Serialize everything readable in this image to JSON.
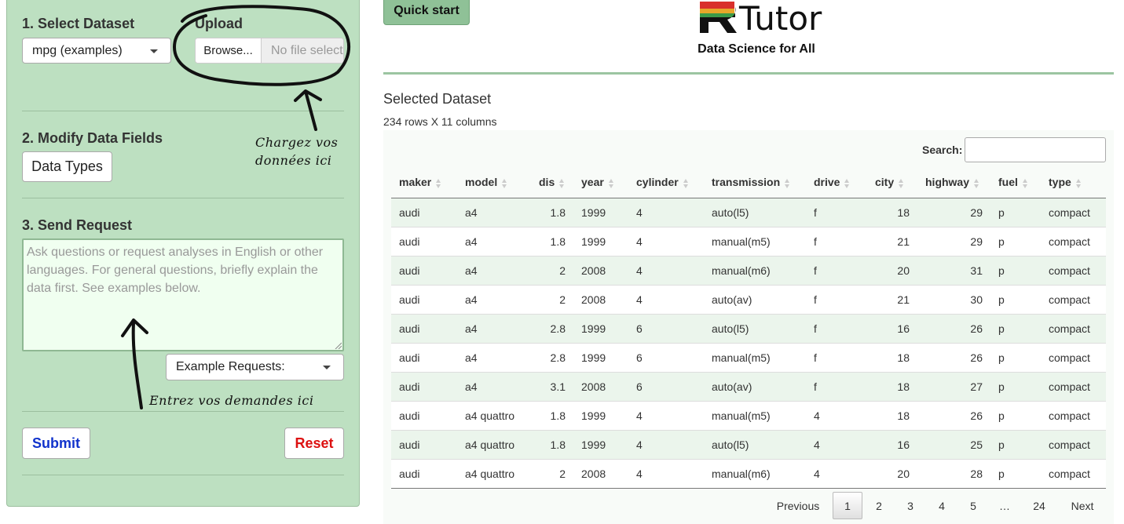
{
  "sidebar": {
    "select_dataset_label": "1. Select Dataset",
    "dataset_value": "mpg (examples)",
    "upload_label": "Upload",
    "browse_label": "Browse...",
    "file_placeholder": "No file selected",
    "modify_label": "2. Modify Data Fields",
    "data_types_label": "Data Types",
    "send_request_label": "3. Send Request",
    "request_placeholder": "Ask questions or request analyses in English or other languages. For general questions, briefly explain the data first. See examples below.",
    "example_requests_label": "Example Requests:",
    "submit_label": "Submit",
    "reset_label": "Reset",
    "annotation_upload": [
      "Chargez vos",
      "données ici"
    ],
    "annotation_request": "Entrez vos demandes ici"
  },
  "colors": {
    "submit": "#1133cc",
    "reset": "#dd1111",
    "sidebar_bg": "#bde0c1",
    "accent": "#8fc197"
  },
  "main": {
    "quick_start_label": "Quick start",
    "logo_text": "Tutor",
    "tagline": "Data Science for All",
    "section_title": "Selected Dataset",
    "dims_text": "234 rows X 11 columns",
    "search_label": "Search:",
    "search_value": ""
  },
  "table": {
    "columns": [
      "maker",
      "model",
      "dis",
      "year",
      "cylinder",
      "transmission",
      "drive",
      "city",
      "highway",
      "fuel",
      "type"
    ],
    "rows": [
      [
        "audi",
        "a4",
        "1.8",
        "1999",
        "4",
        "auto(l5)",
        "f",
        "18",
        "29",
        "p",
        "compact"
      ],
      [
        "audi",
        "a4",
        "1.8",
        "1999",
        "4",
        "manual(m5)",
        "f",
        "21",
        "29",
        "p",
        "compact"
      ],
      [
        "audi",
        "a4",
        "2",
        "2008",
        "4",
        "manual(m6)",
        "f",
        "20",
        "31",
        "p",
        "compact"
      ],
      [
        "audi",
        "a4",
        "2",
        "2008",
        "4",
        "auto(av)",
        "f",
        "21",
        "30",
        "p",
        "compact"
      ],
      [
        "audi",
        "a4",
        "2.8",
        "1999",
        "6",
        "auto(l5)",
        "f",
        "16",
        "26",
        "p",
        "compact"
      ],
      [
        "audi",
        "a4",
        "2.8",
        "1999",
        "6",
        "manual(m5)",
        "f",
        "18",
        "26",
        "p",
        "compact"
      ],
      [
        "audi",
        "a4",
        "3.1",
        "2008",
        "6",
        "auto(av)",
        "f",
        "18",
        "27",
        "p",
        "compact"
      ],
      [
        "audi",
        "a4 quattro",
        "1.8",
        "1999",
        "4",
        "manual(m5)",
        "4",
        "18",
        "26",
        "p",
        "compact"
      ],
      [
        "audi",
        "a4 quattro",
        "1.8",
        "1999",
        "4",
        "auto(l5)",
        "4",
        "16",
        "25",
        "p",
        "compact"
      ],
      [
        "audi",
        "a4 quattro",
        "2",
        "2008",
        "4",
        "manual(m6)",
        "4",
        "20",
        "28",
        "p",
        "compact"
      ]
    ]
  },
  "pagination": {
    "previous": "Previous",
    "pages": [
      "1",
      "2",
      "3",
      "4",
      "5",
      "…",
      "24"
    ],
    "current": "1",
    "next": "Next"
  }
}
